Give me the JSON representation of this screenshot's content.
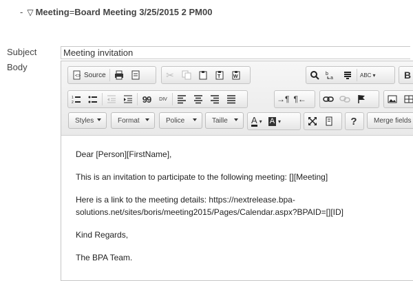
{
  "filter": {
    "prefix": "-",
    "field": "Meeting",
    "operator": "=",
    "value": "Board Meeting 3/25/2015 2 PM00"
  },
  "labels": {
    "subject": "Subject",
    "body": "Body"
  },
  "subject": {
    "value": "Meeting invitation"
  },
  "toolbar": {
    "source_label": "Source",
    "styles_label": "Styles",
    "format_label": "Format",
    "font_label": "Police",
    "size_label": "Taille",
    "merge_label": "Merge fields",
    "text_color_glyph": "A",
    "bg_color_glyph": "A",
    "help_glyph": "?",
    "bold_glyph": "B",
    "blockquote_glyph": "99",
    "div_glyph": "DIV",
    "spell_glyph": "ABC"
  },
  "body": {
    "line1": "Dear [Person][FirstName],",
    "line2": "This is an invitation to participate to the following meeting: [][Meeting]",
    "line3": "Here is a link to the meeting details: https://nextrelease.bpa-",
    "line4": "solutions.net/sites/boris/meeting2015/Pages/Calendar.aspx?BPAID=[][ID]",
    "line5": "Kind Regards,",
    "line6": "The BPA Team."
  }
}
